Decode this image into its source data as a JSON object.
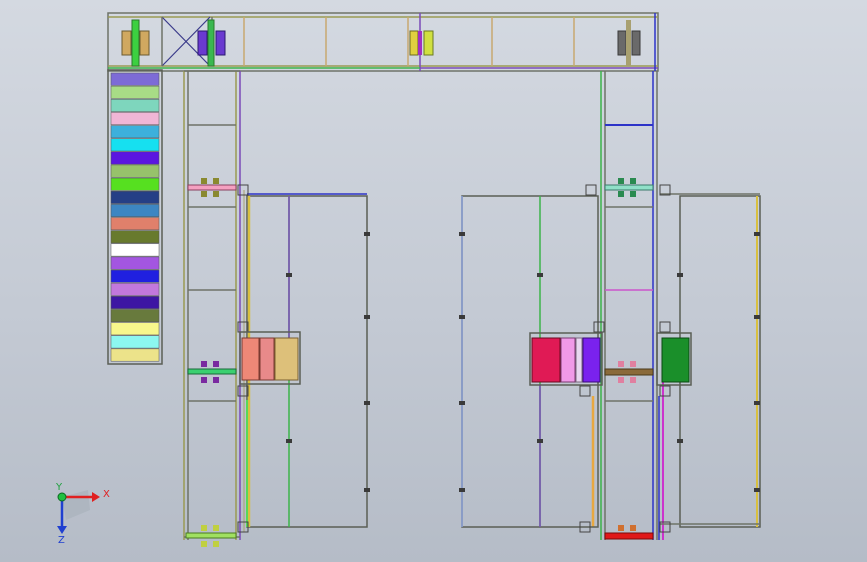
{
  "scene": {
    "background_top": "#d4d9e1",
    "background_bottom": "#b5bcc7"
  },
  "colors": {
    "frame_gray": "#6e7368",
    "olive": "#9a9a52",
    "teal": "#5aa8a0",
    "purple": "#7a4ab8",
    "blue": "#2d33c8",
    "yellow": "#d8c040",
    "green": "#3cb44a",
    "magenta": "#cc33cc",
    "salmon": "#ee8877",
    "tan": "#ddc07a",
    "crimson": "#e01a55",
    "pink_light": "#f09ae8",
    "violet": "#7a22ee",
    "dark_green": "#1a8f2a",
    "red": "#e01818",
    "brown": "#8a6a3a"
  },
  "stack_colors": [
    "#7d6bd6",
    "#a8dc86",
    "#7ed6bd",
    "#f0b6d6",
    "#3db0dc",
    "#16e0f0",
    "#5b16e0",
    "#97c26b",
    "#56e020",
    "#253f86",
    "#3d86c2",
    "#e0806b",
    "#687a2d",
    "#ffffff",
    "#a356e0",
    "#2020e0",
    "#c278dc",
    "#3d16a3",
    "#687a3d",
    "#f7f78c",
    "#8cf7f0",
    "#ece38a"
  ],
  "triad": {
    "x_label": "X",
    "y_label": "Y",
    "z_label": "Z"
  }
}
